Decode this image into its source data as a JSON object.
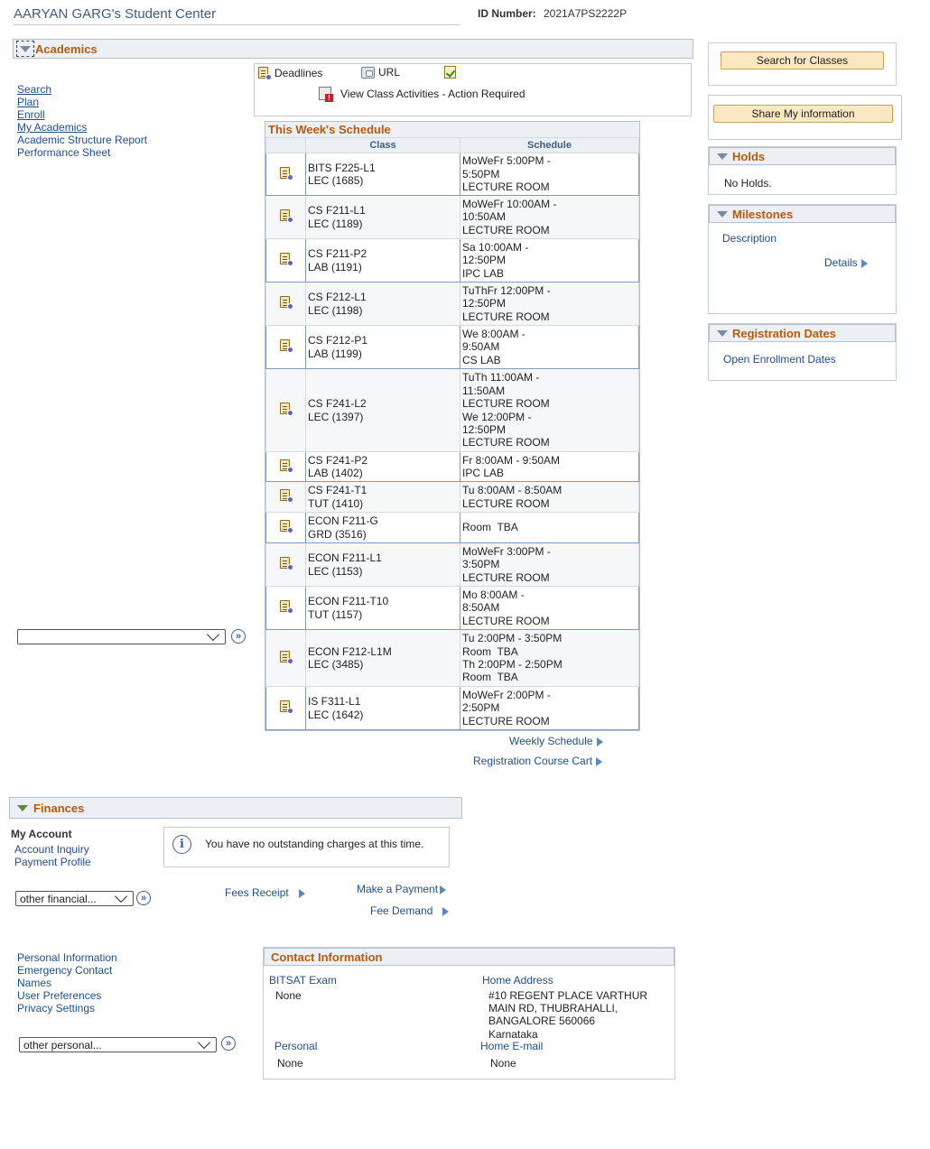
{
  "header": {
    "title": "AARYAN GARG's Student Center",
    "id_label": "ID Number:",
    "id_value": "2021A7PS2222P"
  },
  "academics": {
    "title": "Academics",
    "links": [
      "Search",
      "Plan",
      "Enroll",
      "My Academics",
      "Academic Structure Report",
      "Performance Sheet"
    ],
    "select_value": "",
    "deadlines_label": "Deadlines",
    "url_label": "URL",
    "activities_label": "View Class Activities - Action Required",
    "schedule_title": "This Week's Schedule",
    "col_class": "Class",
    "col_schedule": "Schedule",
    "rows": [
      {
        "class": "BITS F225-L1",
        "section": "LEC (1685)",
        "schedule": [
          "MoWeFr 5:00PM -",
          "5:50PM",
          "LECTURE ROOM"
        ]
      },
      {
        "class": "CS F211-L1",
        "section": "LEC (1189)",
        "schedule": [
          "MoWeFr 10:00AM -",
          "10:50AM",
          "LECTURE ROOM"
        ]
      },
      {
        "class": "CS F211-P2",
        "section": "LAB (1191)",
        "schedule": [
          "Sa 10:00AM -",
          "12:50PM",
          "IPC LAB"
        ]
      },
      {
        "class": "CS F212-L1",
        "section": "LEC (1198)",
        "schedule": [
          "TuThFr 12:00PM -",
          "12:50PM",
          "LECTURE ROOM"
        ]
      },
      {
        "class": "CS F212-P1",
        "section": "LAB (1199)",
        "schedule": [
          "We 8:00AM -",
          "9:50AM",
          "CS LAB"
        ]
      },
      {
        "class": "CS F241-L2",
        "section": "LEC (1397)",
        "schedule": [
          "TuTh 11:00AM -",
          "11:50AM",
          "LECTURE ROOM",
          "We 12:00PM -",
          "12:50PM",
          "LECTURE ROOM"
        ]
      },
      {
        "class": "CS F241-P2",
        "section": "LAB (1402)",
        "schedule": [
          "Fr 8:00AM - 9:50AM",
          "IPC LAB"
        ]
      },
      {
        "class": "CS F241-T1",
        "section": "TUT (1410)",
        "schedule": [
          "Tu 8:00AM - 8:50AM",
          "LECTURE ROOM"
        ]
      },
      {
        "class": "ECON F211-G",
        "section": "GRD (3516)",
        "schedule": [
          "Room  TBA"
        ]
      },
      {
        "class": "ECON F211-L1",
        "section": "LEC (1153)",
        "schedule": [
          "MoWeFr 3:00PM -",
          "3:50PM",
          "LECTURE ROOM"
        ]
      },
      {
        "class": "ECON F211-T10",
        "section": "TUT (1157)",
        "schedule": [
          "Mo 8:00AM -",
          "8:50AM",
          "LECTURE ROOM"
        ]
      },
      {
        "class": "ECON F212-L1M",
        "section": "LEC (3485)",
        "schedule": [
          "Tu 2:00PM - 3:50PM",
          "Room  TBA",
          "Th 2:00PM - 2:50PM",
          "Room  TBA"
        ]
      },
      {
        "class": "IS F311-L1",
        "section": "LEC (1642)",
        "schedule": [
          "MoWeFr 2:00PM -",
          "2:50PM",
          "LECTURE ROOM"
        ]
      }
    ],
    "weekly_schedule_link": "Weekly Schedule",
    "cart_link": "Registration Course Cart"
  },
  "right": {
    "search_button": "Search for Classes",
    "share_button": "Share My information",
    "holds_title": "Holds",
    "holds_text": "No Holds.",
    "milestones_title": "Milestones",
    "milestones_description": "Description",
    "milestones_details": "Details",
    "registration_title": "Registration Dates",
    "registration_link": "Open Enrollment Dates"
  },
  "finances": {
    "title": "Finances",
    "my_account": "My Account",
    "links": [
      "Account Inquiry",
      "Payment Profile"
    ],
    "select_value": "other financial...",
    "info_text": "You have no outstanding charges at this time.",
    "fees_receipt": "Fees Receipt",
    "make_payment": "Make a Payment",
    "fee_demand": "Fee Demand"
  },
  "personal": {
    "links": [
      "Personal Information",
      "Emergency Contact",
      "Names",
      "User Preferences",
      "Privacy Settings"
    ],
    "select_value": "other personal..."
  },
  "contact": {
    "title": "Contact Information",
    "bitsat_label": "BITSAT Exam",
    "bitsat_value": "None",
    "home_address_label": "Home Address",
    "home_address_lines": [
      "#10 REGENT PLACE VARTHUR",
      "MAIN RD, THUBRAHALLI,",
      "BANGALORE 560066",
      "Karnataka"
    ],
    "personal_label": "Personal",
    "personal_value": "None",
    "home_email_label": "Home E-mail",
    "home_email_value": "None"
  }
}
